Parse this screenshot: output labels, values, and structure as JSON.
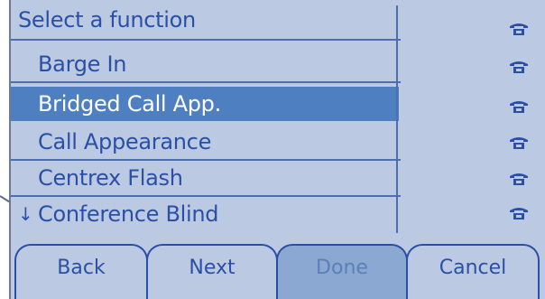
{
  "screen": {
    "title": "Select a function",
    "menu_items": [
      {
        "label": "Barge In",
        "selected": false,
        "arrow": ""
      },
      {
        "label": "Bridged Call App.",
        "selected": true,
        "arrow": ""
      },
      {
        "label": "Call Appearance",
        "selected": false,
        "arrow": ""
      },
      {
        "label": "Centrex Flash",
        "selected": false,
        "arrow": ""
      },
      {
        "label": "Conference Blind",
        "selected": false,
        "arrow": "↓"
      }
    ],
    "line_icons": [
      "phone-icon",
      "phone-icon",
      "phone-icon",
      "phone-icon",
      "phone-icon",
      "phone-icon"
    ],
    "softkeys": [
      {
        "label": "Back"
      },
      {
        "label": "Next"
      },
      {
        "label": "Done",
        "pressed": true
      },
      {
        "label": "Cancel"
      }
    ]
  },
  "colors": {
    "lcd_background": "#bcc9e3",
    "text": "#2a50a5",
    "selection": "#4e7fc0"
  }
}
